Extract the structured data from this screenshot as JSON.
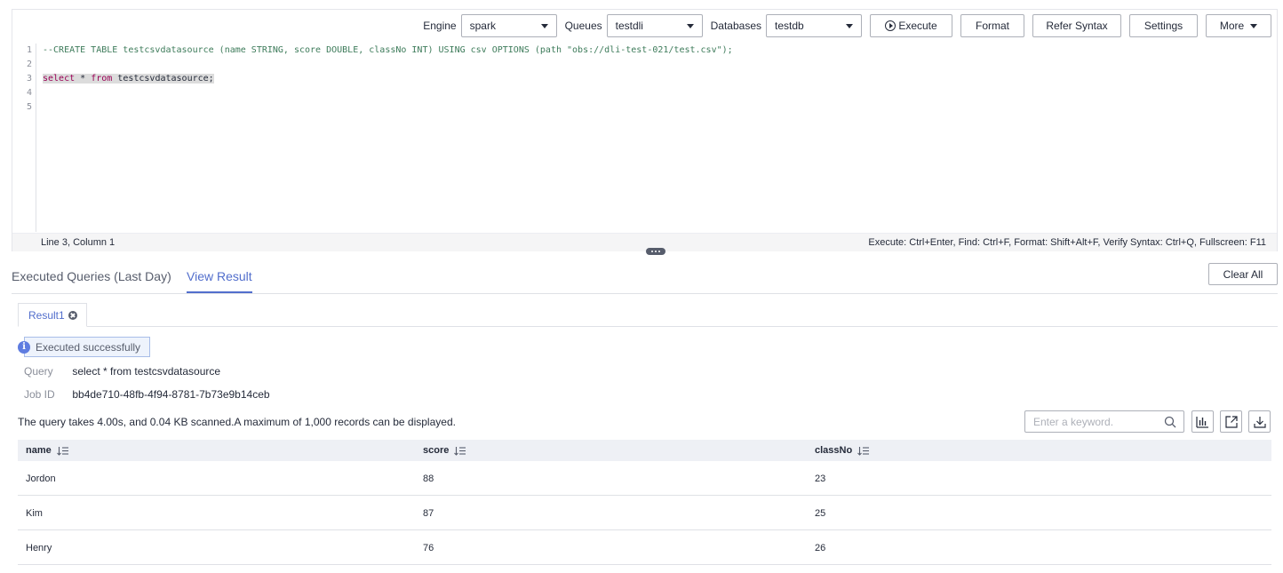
{
  "toolbar": {
    "engine_label": "Engine",
    "engine_value": "spark",
    "queues_label": "Queues",
    "queues_value": "testdli",
    "databases_label": "Databases",
    "databases_value": "testdb",
    "execute_label": "Execute",
    "format_label": "Format",
    "refer_syntax_label": "Refer Syntax",
    "settings_label": "Settings",
    "more_label": "More"
  },
  "editor": {
    "line_numbers": [
      "1",
      "2",
      "3",
      "4",
      "5"
    ],
    "line1": "--CREATE TABLE testcsvdatasource (name STRING, score DOUBLE, classNo INT) USING csv OPTIONS (path \"obs://dli-test-021/test.csv\");",
    "line3_kw1": "select",
    "line3_mid": " * ",
    "line3_kw2": "from",
    "line3_rest": " testcsvdatasource;",
    "cursor_status": "Line 3, Column 1",
    "shortcuts": "Execute: Ctrl+Enter, Find: Ctrl+F, Format: Shift+Alt+F, Verify Syntax: Ctrl+Q, Fullscreen: F11"
  },
  "tabs": {
    "executed_queries": "Executed Queries (Last Day)",
    "view_result": "View Result",
    "clear_all": "Clear All"
  },
  "result": {
    "tab_label": "Result1",
    "status": "Executed successfully",
    "query_label": "Query",
    "query_value": "select * from testcsvdatasource",
    "job_label": "Job ID",
    "job_value": "bb4de710-48fb-4f94-8781-7b73e9b14ceb",
    "summary": "The query takes 4.00s, and 0.04 KB scanned.A maximum of 1,000 records can be displayed.",
    "search_placeholder": "Enter a keyword."
  },
  "table": {
    "columns": [
      "name",
      "score",
      "classNo"
    ],
    "rows": [
      [
        "Jordon",
        "88",
        "23"
      ],
      [
        "Kim",
        "87",
        "25"
      ],
      [
        "Henry",
        "76",
        "26"
      ]
    ]
  },
  "colors": {
    "accent": "#526ecc",
    "info": "#5e7ce0",
    "keyword": "#990055",
    "comment": "#3d7b5a"
  },
  "icons": [
    "play-icon",
    "chevron-down-icon",
    "close-icon",
    "info-icon",
    "search-icon",
    "chart-icon",
    "export-icon",
    "download-icon",
    "sort-icon"
  ]
}
